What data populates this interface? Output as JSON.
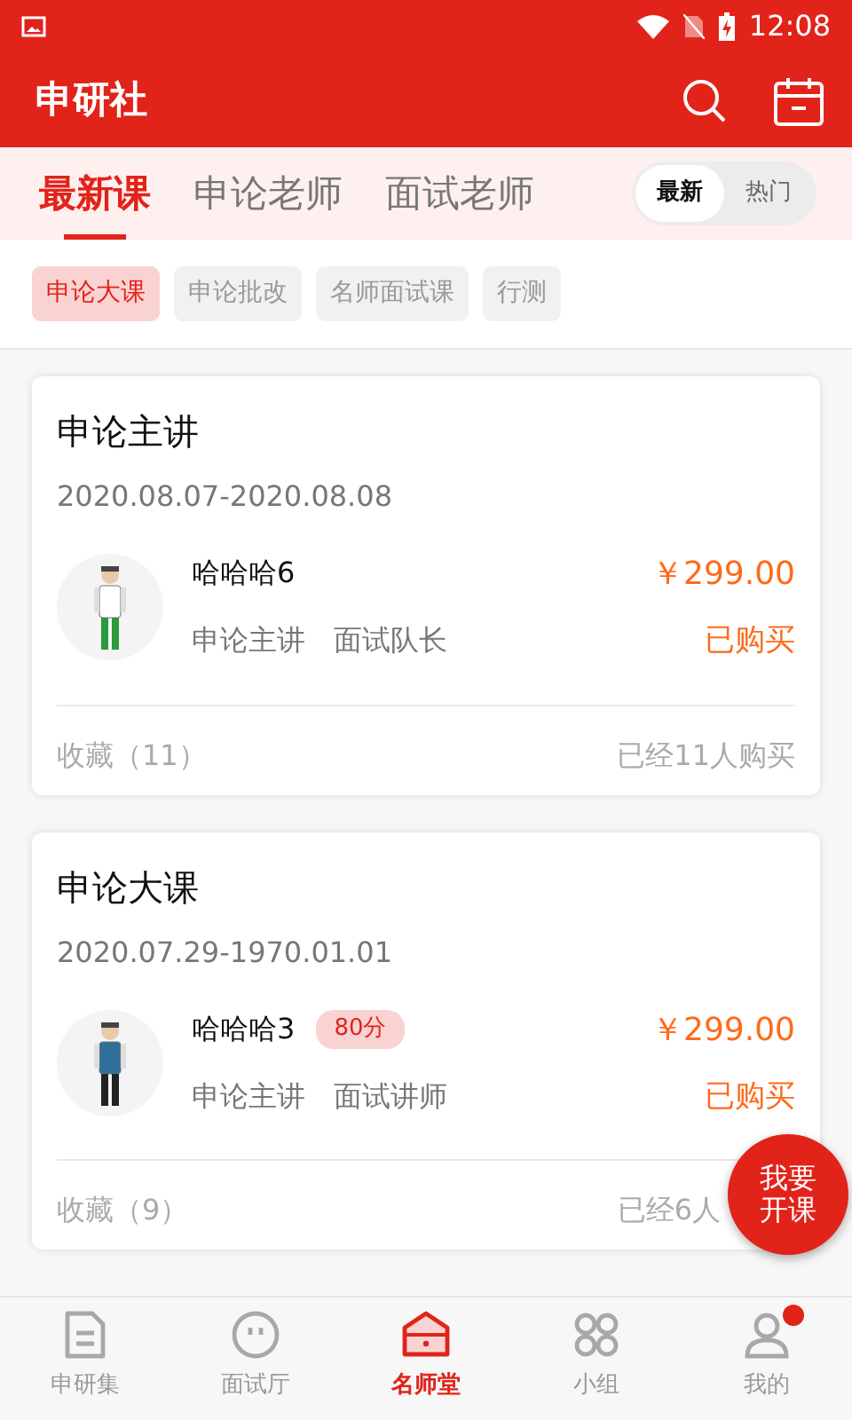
{
  "status_bar": {
    "time": "12:08"
  },
  "app_bar": {
    "title": "申研社"
  },
  "tabs": [
    {
      "label": "最新课",
      "selected": true
    },
    {
      "label": "申论老师",
      "selected": false
    },
    {
      "label": "面试老师",
      "selected": false
    }
  ],
  "sort_toggle": [
    {
      "label": "最新",
      "selected": true
    },
    {
      "label": "热门",
      "selected": false
    }
  ],
  "filters": [
    {
      "label": "申论大课",
      "selected": true
    },
    {
      "label": "申论批改",
      "selected": false
    },
    {
      "label": "名师面试课",
      "selected": false
    },
    {
      "label": "行测",
      "selected": false
    }
  ],
  "courses": [
    {
      "title": "申论主讲",
      "dates": "2020.08.07-2020.08.08",
      "teacher": "哈哈哈6",
      "roles": [
        "申论主讲",
        "面试队长"
      ],
      "price": "￥299.00",
      "status": "已购买",
      "favorites": "收藏（11）",
      "buyers": "已经11人购买"
    },
    {
      "title": "申论大课",
      "dates": "2020.07.29-1970.01.01",
      "teacher": "哈哈哈3",
      "score": "80分",
      "roles": [
        "申论主讲",
        "面试讲师"
      ],
      "price": "￥299.00",
      "status": "已购买",
      "favorites": "收藏（9）",
      "buyers": "已经6人"
    }
  ],
  "fab": {
    "lines": [
      "我要",
      "开课"
    ]
  },
  "bottom_nav": [
    {
      "label": "申研集",
      "selected": false,
      "badge": false
    },
    {
      "label": "面试厅",
      "selected": false,
      "badge": false
    },
    {
      "label": "名师堂",
      "selected": true,
      "badge": false
    },
    {
      "label": "小组",
      "selected": false,
      "badge": false
    },
    {
      "label": "我的",
      "selected": false,
      "badge": true
    }
  ]
}
